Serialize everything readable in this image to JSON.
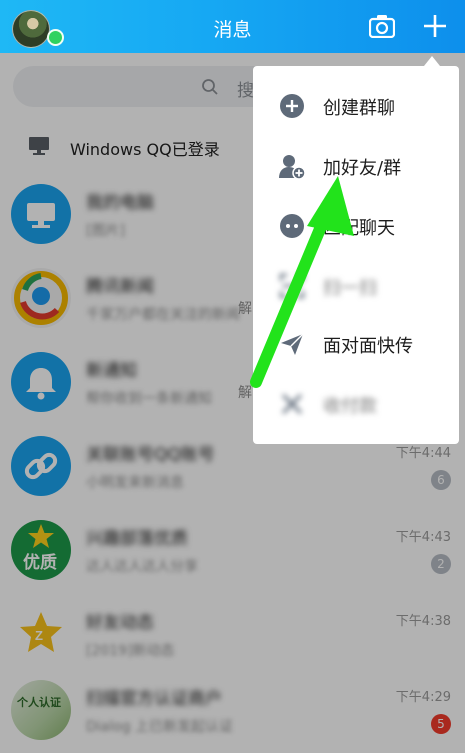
{
  "header": {
    "title": "消息"
  },
  "search": {
    "placeholder": "搜索"
  },
  "windows_bar": {
    "text": "Windows QQ已登录"
  },
  "menu": {
    "items": [
      {
        "label": "创建群聊",
        "icon": "add-group-icon"
      },
      {
        "label": "加好友/群",
        "icon": "add-friend-icon"
      },
      {
        "label": "匹配聊天",
        "icon": "match-chat-icon"
      },
      {
        "label": "扫一扫",
        "icon": "scan-icon"
      },
      {
        "label": "面对面快传",
        "icon": "send-icon"
      },
      {
        "label": "收付款",
        "icon": "payment-icon"
      }
    ]
  },
  "chats": [
    {
      "name": "我的电脑",
      "preview": "[图片]",
      "time": "",
      "badge": ""
    },
    {
      "name": "腾讯新闻",
      "preview": "千家万户都在关注的新闻",
      "time": "",
      "badge": "",
      "extra": "解"
    },
    {
      "name": "新通知",
      "preview": "帮你收到一条新通知",
      "time": "",
      "badge": "",
      "extra": "解"
    },
    {
      "name": "关联账号QQ账号",
      "preview": "小明发来新消息",
      "time": "下午4:44",
      "badge": "6"
    },
    {
      "name": "兴趣部落优质",
      "preview": "达人达人达人分享",
      "time": "下午4:43",
      "badge": "2"
    },
    {
      "name": "好友动态",
      "preview": "[2019]新动态",
      "time": "下午4:38",
      "badge": ""
    },
    {
      "name": "扫描官方认证商户",
      "preview": "Dialog 上已新发起认证",
      "time": "下午4:29",
      "badge": "5"
    }
  ],
  "chat_labels": {
    "youzhi": "优质",
    "renzheng": "个人认证"
  },
  "colors": {
    "header": "#16a8f3",
    "accent_green": "#22e31b",
    "badge_red": "#f23b2c"
  }
}
